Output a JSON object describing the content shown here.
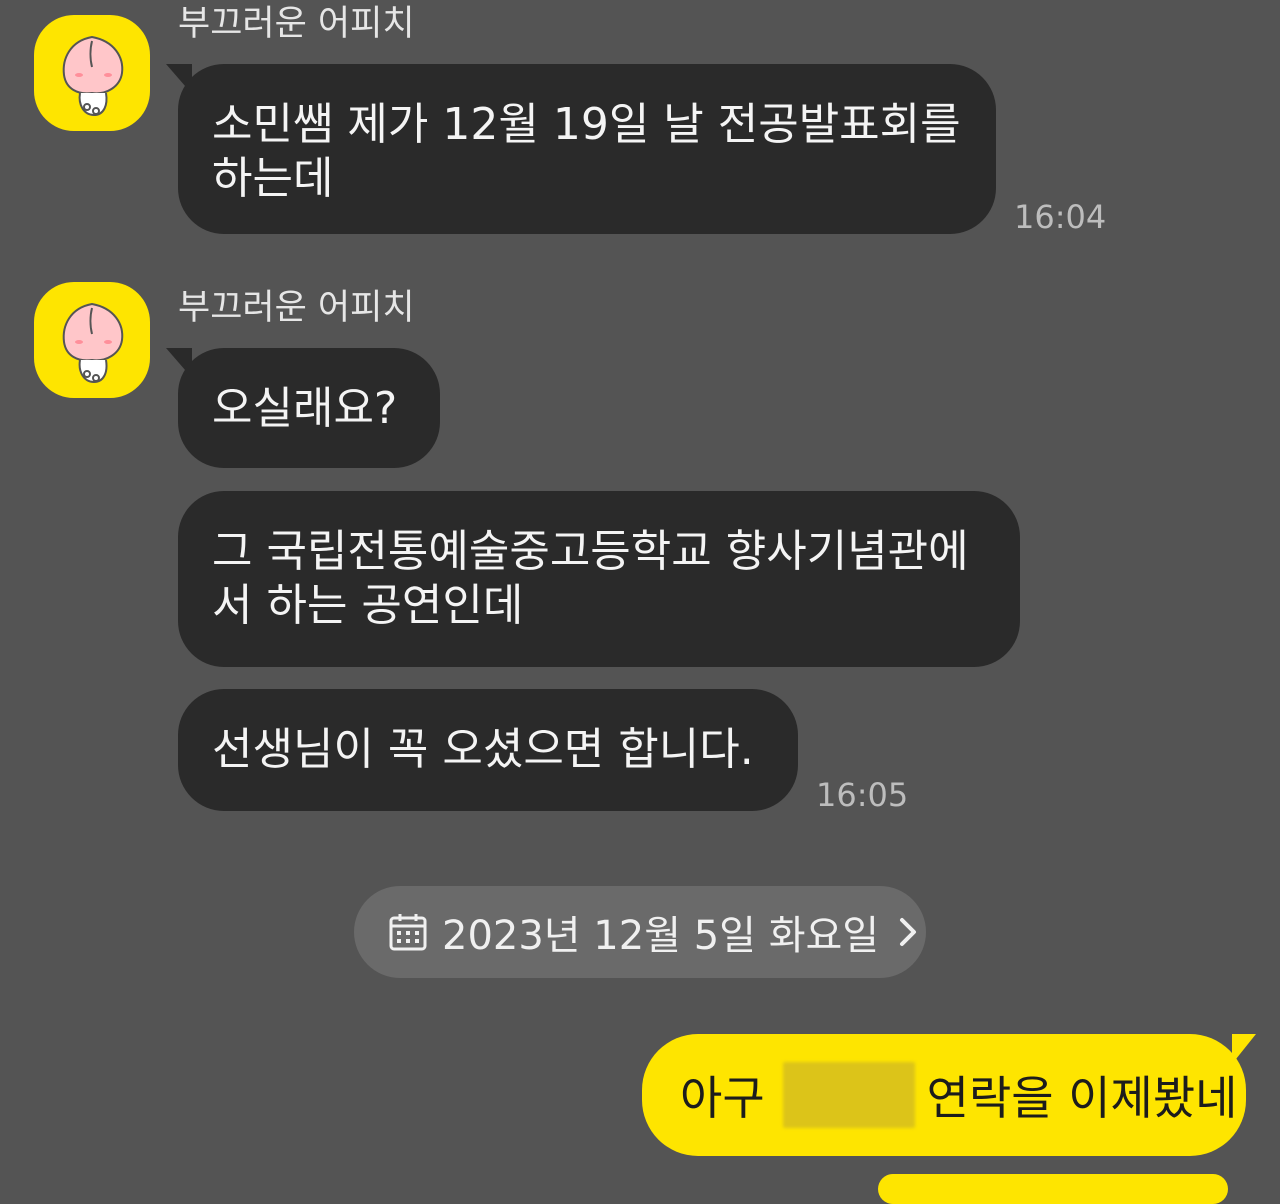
{
  "colors": {
    "background": "#545454",
    "received_bubble": "#2a2a2a",
    "sent_bubble": "#FEE500",
    "avatar_bg": "#FEE500"
  },
  "messages": [
    {
      "sender": "부끄러운 어피치",
      "avatar_icon": "apeach-avatar-icon",
      "lines": [
        "소민쌤 제가 12월 19일 날 전공발표회를",
        "하는데"
      ],
      "time": "16:04"
    },
    {
      "sender": "부끄러운 어피치",
      "avatar_icon": "apeach-avatar-icon",
      "lines": [
        "오실래요?"
      ]
    },
    {
      "lines": [
        "그 국립전통예술중고등학교 향사기념관에",
        "서 하는 공연인데"
      ]
    },
    {
      "lines": [
        "선생님이 꼭 오셨으면 합니다."
      ],
      "time": "16:05"
    }
  ],
  "date_divider": {
    "icon": "calendar-icon",
    "label": "2023년 12월 5일 화요일",
    "chevron": "chevron-right-icon"
  },
  "my_message": {
    "before": "아구",
    "after": "연락을 이제봤네",
    "redacted": true
  }
}
